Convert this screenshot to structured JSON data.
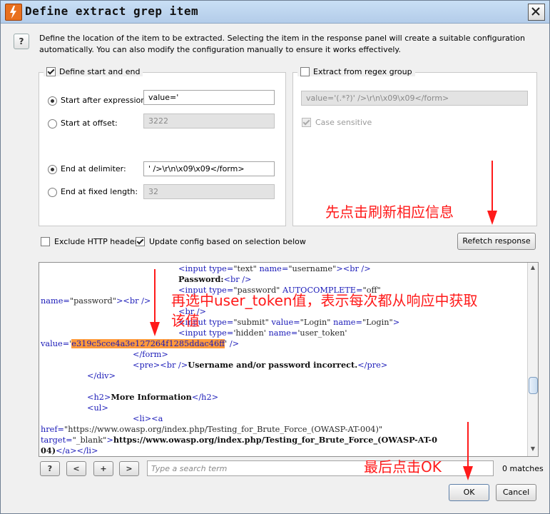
{
  "dialog": {
    "title": "Define extract grep item",
    "description": "Define the location of the item to be extracted. Selecting the item in the response panel will create a suitable configuration automatically. You can also modify the configuration manually to ensure it works effectively.",
    "help_label": "?"
  },
  "start_end": {
    "legend": "Define start and end",
    "checked": true,
    "start_after_label": "Start after expression:",
    "start_after_value": "value='",
    "start_offset_label": "Start at offset:",
    "start_offset_value": "3222",
    "end_delimiter_label": "End at delimiter:",
    "end_delimiter_value": "' />\\r\\n\\x09\\x09</form>",
    "end_fixed_label": "End at fixed length:",
    "end_fixed_value": "32"
  },
  "regex": {
    "legend": "Extract from regex group",
    "checked": false,
    "value": "value='(.*?)' />\\r\\n\\x09\\x09</form>",
    "case_label": "Case sensitive",
    "case_checked": true
  },
  "options": {
    "exclude_headers": "Exclude HTTP headers",
    "exclude_checked": false,
    "update_config": "Update config based on selection below",
    "update_checked": true,
    "refetch": "Refetch response"
  },
  "response": {
    "l1": [
      {
        "c": "t",
        "s": "<input "
      },
      {
        "c": "n",
        "s": "type="
      },
      {
        "c": "v",
        "s": "\"text\" "
      },
      {
        "c": "n",
        "s": "name="
      },
      {
        "c": "v",
        "s": "\"username\""
      },
      {
        "c": "t",
        "s": "><br />"
      }
    ],
    "l2": [
      {
        "c": "b",
        "s": "Password:"
      },
      {
        "c": "t",
        "s": "<br />"
      }
    ],
    "l3": [
      {
        "c": "t",
        "s": "<input "
      },
      {
        "c": "n",
        "s": "type="
      },
      {
        "c": "v",
        "s": "\"password\" "
      },
      {
        "c": "n",
        "s": "AUTOCOMPLETE="
      },
      {
        "c": "v",
        "s": "\"off\""
      }
    ],
    "l4": [
      {
        "c": "n",
        "s": "name="
      },
      {
        "c": "v",
        "s": "\"password\""
      },
      {
        "c": "t",
        "s": "><br />"
      }
    ],
    "l5": [
      {
        "c": "t",
        "s": "<br />"
      }
    ],
    "l6": [
      {
        "c": "t",
        "s": "<input "
      },
      {
        "c": "n",
        "s": "type="
      },
      {
        "c": "v",
        "s": "\"submit\" "
      },
      {
        "c": "n",
        "s": "value="
      },
      {
        "c": "v",
        "s": "\"Login\" "
      },
      {
        "c": "n",
        "s": "name="
      },
      {
        "c": "v",
        "s": "\"Login\""
      },
      {
        "c": "t",
        "s": ">"
      }
    ],
    "l7": [
      {
        "c": "t",
        "s": "<input "
      },
      {
        "c": "n",
        "s": "type="
      },
      {
        "c": "v",
        "s": "'hidden' "
      },
      {
        "c": "n",
        "s": "name="
      },
      {
        "c": "v",
        "s": "'user_token'"
      }
    ],
    "l8": [
      {
        "c": "n",
        "s": "value="
      },
      {
        "c": "v",
        "s": "'"
      },
      {
        "c": "hl",
        "s": "e319c5cce4a3e127264f1285ddac46ff"
      },
      {
        "c": "v",
        "s": "' "
      },
      {
        "c": "t",
        "s": "/>"
      }
    ],
    "l9": [
      {
        "c": "t",
        "s": "</form>"
      }
    ],
    "l10": [
      {
        "c": "t",
        "s": "<pre><br />"
      },
      {
        "c": "b",
        "s": "Username and/or password incorrect."
      },
      {
        "c": "t",
        "s": "</pre>"
      }
    ],
    "l11": [
      {
        "c": "t",
        "s": "</div>"
      }
    ],
    "l12": [
      {
        "c": "t",
        "s": "<h2>"
      },
      {
        "c": "b",
        "s": "More Information"
      },
      {
        "c": "t",
        "s": "</h2>"
      }
    ],
    "l13": [
      {
        "c": "t",
        "s": "<ul>"
      }
    ],
    "l14": [
      {
        "c": "t",
        "s": "<li><a"
      }
    ],
    "l15": [
      {
        "c": "n",
        "s": "href="
      },
      {
        "c": "v",
        "s": "\"https://www.owasp.org/index.php/Testing_for_Brute_Force_(OWASP-AT-004)\""
      }
    ],
    "l16": [
      {
        "c": "n",
        "s": "target="
      },
      {
        "c": "v",
        "s": "\"_blank\""
      },
      {
        "c": "t",
        "s": ">"
      },
      {
        "c": "b",
        "s": "https://www.owasp.org/index.php/Testing_for_Brute_Force_(OWASP-AT-0"
      }
    ],
    "l17": [
      {
        "c": "b",
        "s": "04)"
      },
      {
        "c": "t",
        "s": "</a></li>"
      }
    ]
  },
  "search": {
    "help": "?",
    "prev": "<",
    "add": "+",
    "next": ">",
    "placeholder": "Type a search term",
    "matches": "0 matches"
  },
  "footer": {
    "ok": "OK",
    "cancel": "Cancel"
  },
  "annotations": {
    "refetch_note": "先点击刷新相应信息",
    "token_note_1": "再选中user_token值，表示每次都从响应中获取",
    "token_note_2": "该值",
    "ok_note": "最后点击OK",
    "color": "#ff1a1a"
  }
}
